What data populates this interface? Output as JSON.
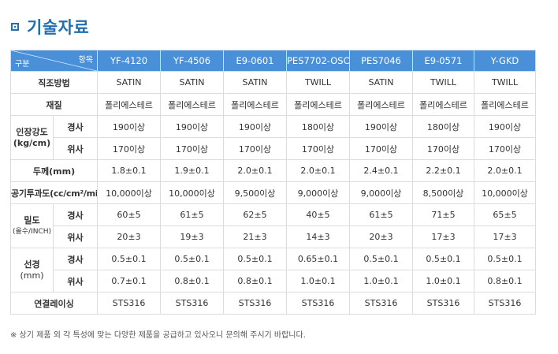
{
  "title": "기술자료",
  "header": {
    "corner_top": "항목",
    "corner_bottom": "구분",
    "models": [
      "YF-4120",
      "YF-4506",
      "E9-0601",
      "PES7702-OSC",
      "PES7046",
      "E9-0571",
      "Y-GKD"
    ]
  },
  "rows": {
    "weave": {
      "label": "직조방법",
      "values": [
        "SATIN",
        "SATIN",
        "SATIN",
        "TWILL",
        "SATIN",
        "TWILL",
        "TWILL"
      ]
    },
    "material": {
      "label": "재질",
      "values": [
        "폴리에스테르",
        "폴리에스테르",
        "폴리에스테르",
        "폴리에스테르",
        "폴리에스테르",
        "폴리에스테르",
        "폴리에스테르"
      ]
    },
    "tensile": {
      "label_1": "인장강도",
      "label_2": "(kg/cm)",
      "warp": {
        "label": "경사",
        "values": [
          "190이상",
          "190이상",
          "190이상",
          "180이상",
          "190이상",
          "180이상",
          "190이상"
        ]
      },
      "weft": {
        "label": "위사",
        "values": [
          "170이상",
          "170이상",
          "170이상",
          "170이상",
          "170이상",
          "170이상",
          "170이상"
        ]
      }
    },
    "thickness": {
      "label": "두께(mm)",
      "values": [
        "1.8±0.1",
        "1.9±0.1",
        "2.0±0.1",
        "2.0±0.1",
        "2.4±0.1",
        "2.2±0.1",
        "2.0±0.1"
      ]
    },
    "air": {
      "label": "공기투과도(cc/cm²/min)",
      "values": [
        "10,000이상",
        "10,000이상",
        "9,500이상",
        "9,000이상",
        "9,000이상",
        "8,500이상",
        "10,000이상"
      ]
    },
    "density": {
      "label_1": "밀도",
      "label_2": "(올수/INCH)",
      "warp": {
        "label": "경사",
        "values": [
          "60±5",
          "61±5",
          "62±5",
          "40±5",
          "61±5",
          "71±5",
          "65±5"
        ]
      },
      "weft": {
        "label": "위사",
        "values": [
          "20±3",
          "19±3",
          "21±3",
          "14±3",
          "20±3",
          "17±3",
          "17±3"
        ]
      }
    },
    "diameter": {
      "label_1": "선경",
      "label_2": "(mm)",
      "warp": {
        "label": "경사",
        "values": [
          "0.5±0.1",
          "0.5±0.1",
          "0.5±0.1",
          "0.65±0.1",
          "0.5±0.1",
          "0.5±0.1",
          "0.5±0.1"
        ]
      },
      "weft": {
        "label": "위사",
        "values": [
          "0.7±0.1",
          "0.8±0.1",
          "0.8±0.1",
          "1.0±0.1",
          "1.0±0.1",
          "1.0±0.1",
          "0.8±0.1"
        ]
      }
    },
    "lacing": {
      "label": "연결레이싱",
      "values": [
        "STS316",
        "STS316",
        "STS316",
        "STS316",
        "STS316",
        "STS316",
        "STS316"
      ]
    }
  },
  "note": "※ 상기 제품 외 각 특성에 맞는 다양한 제품을 공급하고 있사오니 문의해 주시기 바랍니다.",
  "colors": {
    "accent": "#1f6fb2",
    "header_bg": "#4a90d9",
    "border": "#d9dde3"
  }
}
